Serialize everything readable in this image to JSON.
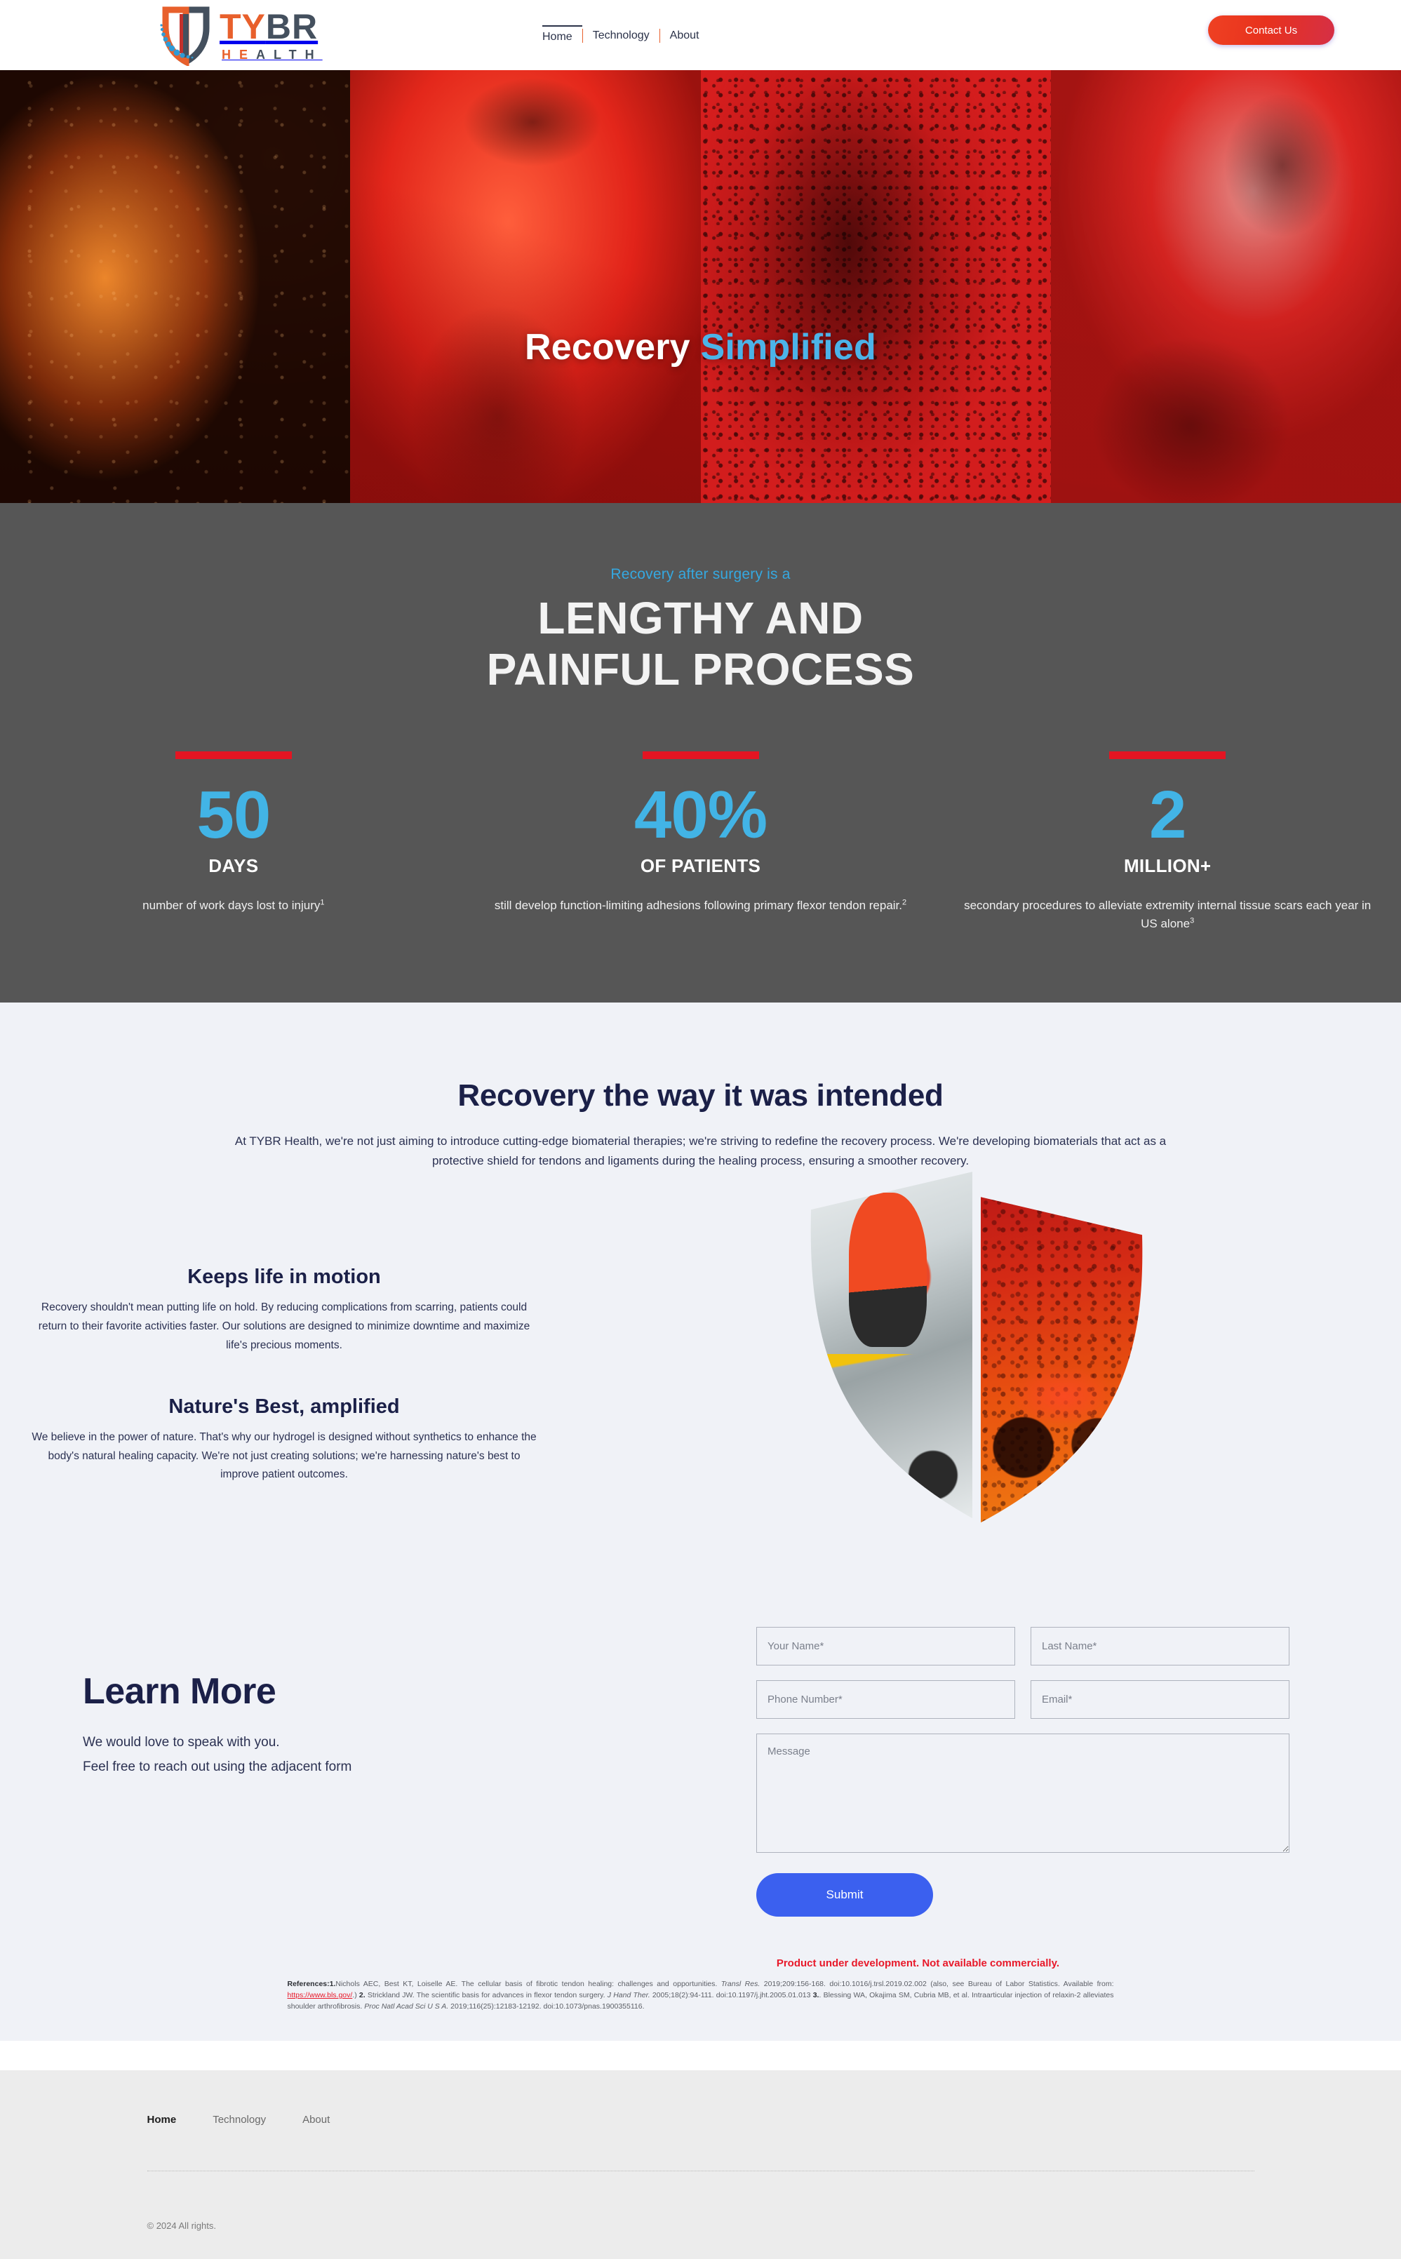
{
  "header": {
    "logo": {
      "word_part1": "TY",
      "word_part2": "BR",
      "sub_part1": "HE",
      "sub_part2": "ALTH",
      "alt": "TYBR HEALTH"
    },
    "nav": [
      {
        "label": "Home",
        "active": true
      },
      {
        "label": "Technology",
        "active": false
      },
      {
        "label": "About",
        "active": false
      }
    ],
    "contact_label": "Contact Us"
  },
  "hero": {
    "title_white": "Recovery",
    "title_blue": "Simplified"
  },
  "stats": {
    "kicker": "Recovery after surgery is a",
    "headline_line1": "LENGTHY AND",
    "headline_line2": "PAINFUL PROCESS",
    "items": [
      {
        "number": "50",
        "label": "DAYS",
        "desc": "number of work days lost to injury",
        "footnote": "1"
      },
      {
        "number": "40%",
        "label": "OF PATIENTS",
        "desc": "still develop function-limiting adhesions following primary flexor tendon repair.",
        "footnote": "2"
      },
      {
        "number": "2",
        "label": "MILLION+",
        "desc": "secondary procedures to alleviate extremity internal tissue scars each year in US alone",
        "footnote": "3"
      }
    ],
    "accent_bar_color": "#e41522",
    "number_color": "#42b4e6",
    "bg_color": "#565656"
  },
  "intended": {
    "heading": "Recovery the way it was intended",
    "paragraph": "At TYBR Health, we're not just aiming to introduce cutting-edge biomaterial therapies; we're striving to redefine the recovery process. We're developing biomaterials that act as a protective shield for tendons and ligaments during the healing process, ensuring a smoother recovery."
  },
  "features": [
    {
      "title": "Keeps life in motion",
      "body": "Recovery shouldn't mean putting life on hold. By reducing complications from scarring, patients could return to their favorite activities faster. Our solutions are designed to minimize downtime and maximize life's precious moments."
    },
    {
      "title": "Nature's Best, amplified",
      "body": "We believe in the power of nature. That's why our hydrogel is designed without synthetics to enhance the body's natural healing capacity. We're not just creating solutions; we're harnessing nature's best to improve patient outcomes."
    }
  ],
  "shield_image": {
    "left_alt": "cyclist riding fat-bike in snow",
    "right_alt": "cyclist riding fat-bike, orange-red duotone"
  },
  "learn": {
    "heading": "Learn More",
    "line1": "We would love to speak with you.",
    "line2": "Feel free to reach out using the adjacent form"
  },
  "form": {
    "first_name_placeholder": "Your Name*",
    "last_name_placeholder": "Last Name*",
    "phone_placeholder": "Phone Number*",
    "email_placeholder": "Email*",
    "message_placeholder": "Message",
    "first_name_value": "",
    "last_name_value": "",
    "phone_value": "",
    "email_value": "",
    "message_value": "",
    "submit_label": "Submit",
    "submit_color": "#3b60ef"
  },
  "notice": {
    "text": "Product under development. Not available commercially.",
    "color": "#e8192a"
  },
  "references": {
    "title": "References:",
    "n1": "1.",
    "r1a": "Nichols AEC, Best KT, Loiselle AE. The cellular basis of fibrotic tendon healing: challenges and opportunities. ",
    "r1_italic": "Transl Res.",
    "r1b": " 2019;209:156-168. doi:10.1016/j.trsl.2019.02.002 (also, see Bureau of Labor Statistics. Available from: ",
    "r1_link": "https://www.bls.gov/",
    "r1c": ".) ",
    "n2": "2.",
    "r2a": " Strickland JW. The scientific basis for advances in flexor tendon surgery. ",
    "r2_italic": "J Hand Ther.",
    "r2b": " 2005;18(2):94-111. doi:10.1197/j.jht.2005.01.013  ",
    "n3": "3.",
    "r3a": ". Blessing WA, Okajima SM, Cubria MB, et al. Intraarticular injection of relaxin-2 alleviates shoulder arthrofibrosis. ",
    "r3_italic": "Proc Natl Acad Sci U S A.",
    "r3b": " 2019;116(25):12183-12192. doi:10.1073/pnas.1900355116."
  },
  "footer": {
    "nav": [
      {
        "label": "Home",
        "active": true
      },
      {
        "label": "Technology",
        "active": false
      },
      {
        "label": "About",
        "active": false
      }
    ],
    "copyright": "© 2024 All rights."
  }
}
